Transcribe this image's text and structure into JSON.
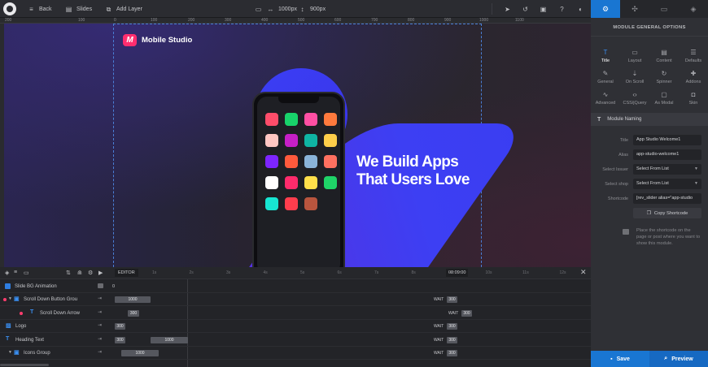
{
  "toolbar": {
    "back_label": "Back",
    "slides_label": "Slides",
    "add_layer_label": "Add Layer",
    "width_value": "1000px",
    "height_value": "900px"
  },
  "ruler": {
    "top_ticks": [
      "200",
      "100",
      "0",
      "100",
      "200",
      "300",
      "400",
      "500",
      "600",
      "700",
      "800",
      "900",
      "1000",
      "1100"
    ],
    "left_ticks": [
      "0",
      "100",
      "200",
      "300",
      "400",
      "500",
      "600"
    ]
  },
  "stage": {
    "brand_name": "Mobile Studio",
    "heading_line1": "We Build Apps",
    "heading_line2": "That Users Love",
    "app_icon_colors": [
      "#ff4d6a",
      "#18d36a",
      "#ff4fa3",
      "#ff7a3d",
      "#ffc7c2",
      "#c61fc6",
      "#0fb5a3",
      "#ffcf4a",
      "#7d25ff",
      "#ff5a3c",
      "#8ab4d9",
      "#ff7160",
      "#ffffff",
      "#ff2b6b",
      "#ffe04a",
      "#1fd468",
      "#17e5d1",
      "#ff3d4d",
      "#b8553e"
    ],
    "blob_color": "#3a34f0"
  },
  "right_panel": {
    "section_title": "MODULE GENERAL OPTIONS",
    "options": [
      {
        "label": "Title",
        "icon": "title-icon",
        "active": true
      },
      {
        "label": "Layout",
        "icon": "layout-icon",
        "active": false
      },
      {
        "label": "Content",
        "icon": "content-icon",
        "active": false
      },
      {
        "label": "Defaults",
        "icon": "defaults-icon",
        "active": false
      },
      {
        "label": "General",
        "icon": "general-icon",
        "active": false
      },
      {
        "label": "On Scroll",
        "icon": "on-scroll-icon",
        "active": false
      },
      {
        "label": "Spinner",
        "icon": "spinner-icon",
        "active": false
      },
      {
        "label": "Addons",
        "icon": "addons-icon",
        "active": false
      },
      {
        "label": "Advanced",
        "icon": "advanced-icon",
        "active": false
      },
      {
        "label": "CSS/jQuery",
        "icon": "code-icon",
        "active": false
      },
      {
        "label": "As Modal",
        "icon": "modal-icon",
        "active": false
      },
      {
        "label": "Skin",
        "icon": "skin-icon",
        "active": false
      }
    ],
    "naming_title": "Module Naming",
    "fields": [
      {
        "label": "Title",
        "value": "App Studio Welcome1"
      },
      {
        "label": "Alias",
        "value": "app-studio-welcome1"
      },
      {
        "label": "Select Issuer",
        "value": "Select From List"
      },
      {
        "label": "Select shop",
        "value": "Select From List"
      },
      {
        "label": "Shortcode",
        "value": "[rev_slider alias=\"app-studio"
      }
    ],
    "copy_shortcode_label": "Copy Shortcode",
    "hint_text": "Place the shortcode on the page or post where you want to show this module.",
    "save_label": "Save",
    "preview_label": "Preview"
  },
  "timeline": {
    "editor_label": "EDITOR",
    "time_value": "00:09:00",
    "ticks": [
      "1s",
      "2s",
      "3s",
      "4s",
      "5s",
      "6s",
      "7s",
      "8s",
      "9s",
      "10s",
      "11s",
      "12s"
    ],
    "bg_row": {
      "name": "Slide BG Animation",
      "value": "0"
    },
    "rows": [
      {
        "name": "Scroll Down Button Grou",
        "start": "1000",
        "wait": "WAIT",
        "end": "300"
      },
      {
        "name": "Scroll Down Arrow",
        "start": "300",
        "wait": "WAIT",
        "end": "300"
      },
      {
        "name": "Logo",
        "start": "300",
        "wait": "WAIT",
        "end": "300"
      },
      {
        "name": "Heading Text",
        "start": "300",
        "mid": "1000",
        "wait": "WAIT",
        "end": "300"
      },
      {
        "name": "Icons Group",
        "start": "1000",
        "wait": "WAIT",
        "end": "300"
      }
    ]
  }
}
